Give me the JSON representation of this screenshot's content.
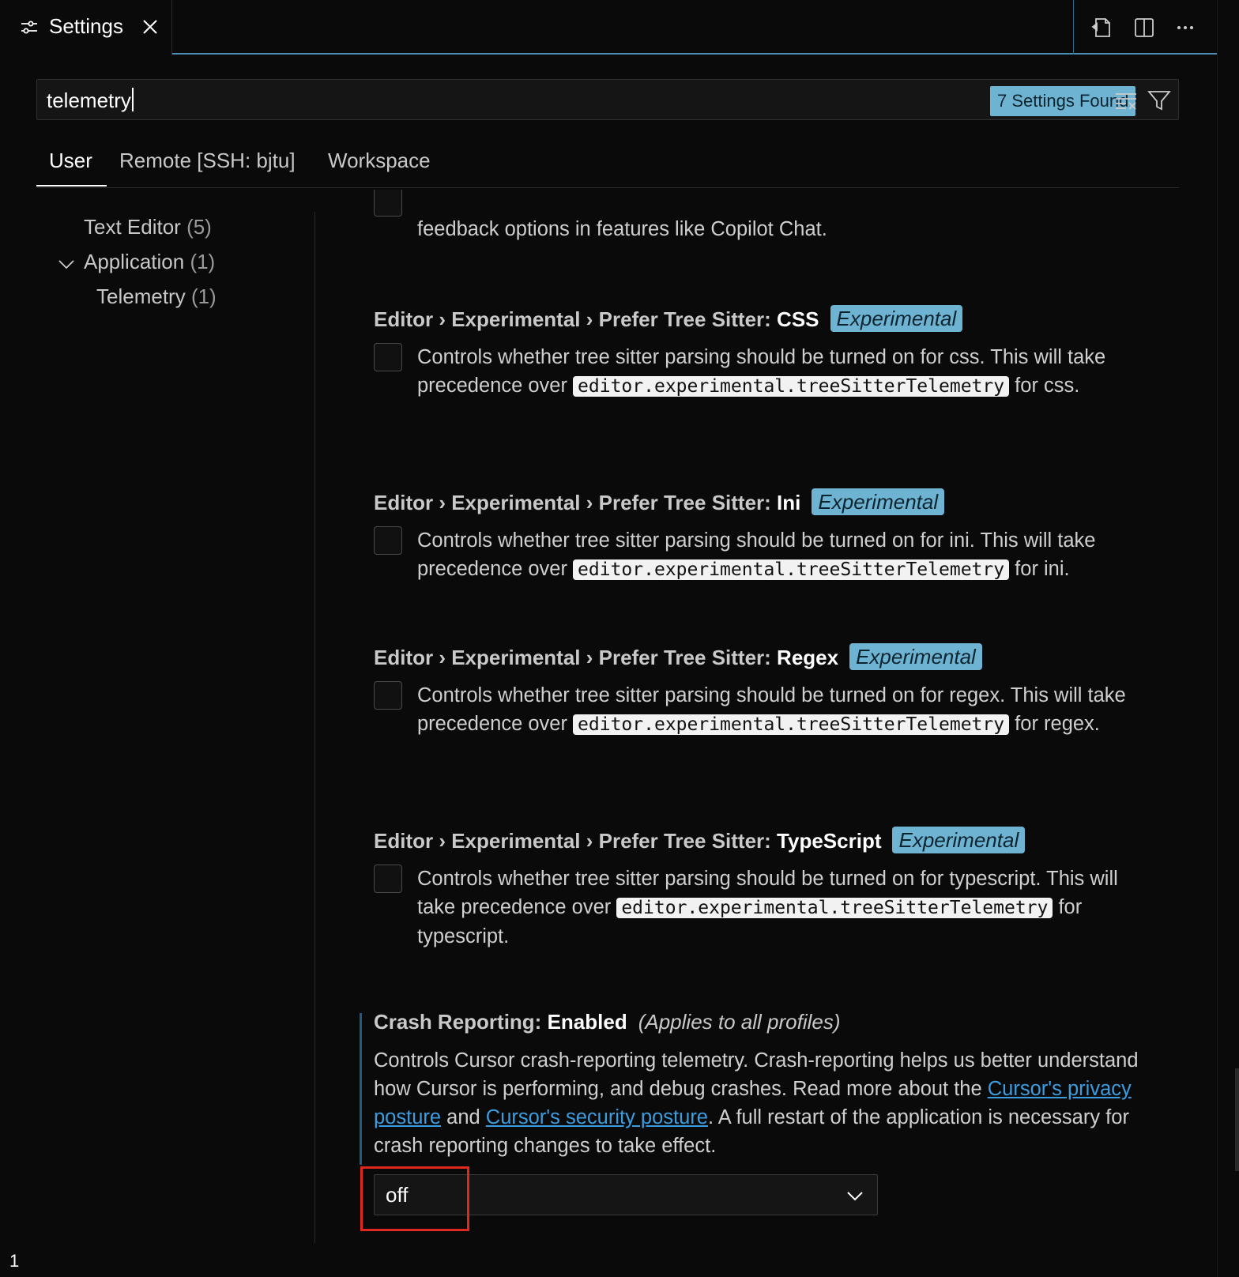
{
  "tab": {
    "icon": "settings-sliders-icon",
    "label": "Settings",
    "close_icon": "close-icon"
  },
  "toolbar_icons": [
    "open-settings-json-icon",
    "split-editor-icon",
    "more-actions-icon"
  ],
  "search": {
    "value": "telemetry",
    "results_badge": "7 Settings Found",
    "clear_icon": "clear-filter-icon",
    "filter_icon": "filter-icon"
  },
  "scopes": [
    "User",
    "Remote [SSH: bjtu]",
    "Workspace"
  ],
  "toc": [
    {
      "label": "Text Editor",
      "count": "(5)"
    },
    {
      "label": "Application",
      "count": "(1)"
    },
    {
      "label": "Telemetry",
      "count": "(1)"
    }
  ],
  "partial_desc": "feedback options in features like Copilot Chat.",
  "settings": [
    {
      "prefix": "Editor › Experimental › Prefer Tree Sitter: ",
      "name": "CSS",
      "badge": "Experimental",
      "desc_before": "Controls whether tree sitter parsing should be turned on for css. This will take precedence over ",
      "code": "editor.experimental.treeSitterTelemetry",
      "desc_after": " for css."
    },
    {
      "prefix": "Editor › Experimental › Prefer Tree Sitter: ",
      "name": "Ini",
      "badge": "Experimental",
      "desc_before": "Controls whether tree sitter parsing should be turned on for ini. This will take precedence over ",
      "code": "editor.experimental.treeSitterTelemetry",
      "desc_after": " for ini."
    },
    {
      "prefix": "Editor › Experimental › Prefer Tree Sitter: ",
      "name": "Regex",
      "badge": "Experimental",
      "desc_before": "Controls whether tree sitter parsing should be turned on for regex. This will take precedence over ",
      "code": "editor.experimental.treeSitterTelemetry",
      "desc_after": " for regex."
    },
    {
      "prefix": "Editor › Experimental › Prefer Tree Sitter: ",
      "name": "TypeScript",
      "badge": "Experimental",
      "desc_before": "Controls whether tree sitter parsing should be turned on for typescript. This will take precedence over ",
      "code": "editor.experimental.treeSitterTelemetry",
      "desc_after": " for typescript."
    }
  ],
  "crash": {
    "prefix": "Crash Reporting: ",
    "name": "Enabled",
    "scope_note": "(Applies to all profiles)",
    "desc_1": "Controls Cursor crash-reporting telemetry. Crash-reporting helps us better understand how Cursor is performing, and debug crashes. Read more about the ",
    "link_1": "Cursor's privacy posture",
    "desc_2": " and ",
    "link_2": "Cursor's security posture",
    "desc_3": ". A full restart of the application is necessary for crash reporting changes to take effect.",
    "value": "off"
  },
  "status_count": "1",
  "colors": {
    "accent": "#6fb3d2",
    "link": "#3b9de0",
    "highlight": "#e0281e"
  }
}
